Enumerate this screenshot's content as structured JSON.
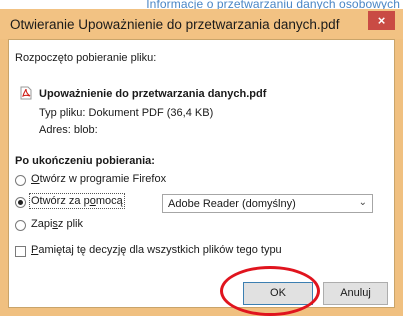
{
  "background": {
    "link_text": "Informacje o przetwarzaniu danych osobowych"
  },
  "dialog": {
    "title": "Otwieranie Upoważnienie do przetwarzania danych.pdf",
    "close_label": "×",
    "download_started": "Rozpoczęto pobieranie pliku:",
    "file_name": "Upoważnienie do przetwarzania danych.pdf",
    "file_type": "Typ pliku: Dokument PDF (36,4 KB)",
    "file_address": "Adres: blob:",
    "after_download_heading": "Po ukończeniu pobierania:",
    "options": {
      "open_in_firefox": {
        "pre": "",
        "accel": "O",
        "post": "twórz w programie Firefox",
        "selected": false
      },
      "open_with": {
        "pre": "Otwórz za p",
        "accel": "o",
        "post": "mocą",
        "selected": true
      },
      "save_file": {
        "pre": "Zapi",
        "accel": "s",
        "post": "z plik",
        "selected": false
      }
    },
    "open_with_select": {
      "value": "Adobe Reader (domyślny)"
    },
    "remember": {
      "pre": "",
      "accel": "P",
      "post": "amiętaj tę decyzję dla wszystkich plików tego typu",
      "checked": false
    },
    "buttons": {
      "ok": "OK",
      "cancel": "Anuluj"
    }
  },
  "colors": {
    "titlebar": "#f2c283",
    "close_button": "#c94b44",
    "annotation_circle": "#e0141e",
    "link": "#4a86c5"
  }
}
